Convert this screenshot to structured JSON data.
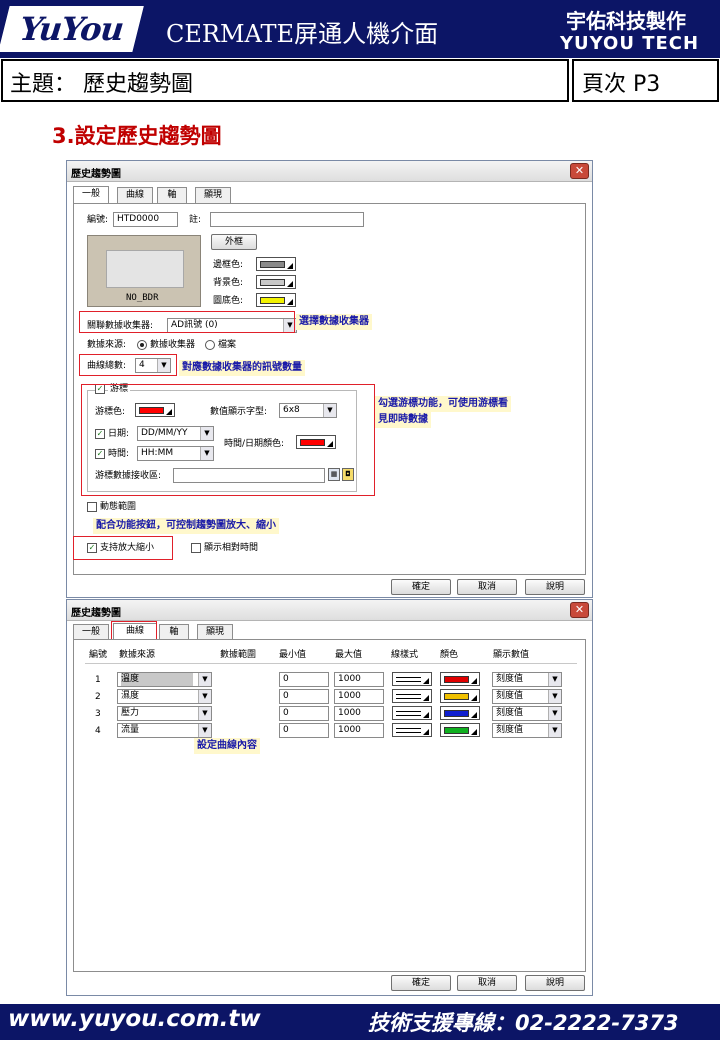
{
  "header": {
    "logo_text": "YuYou",
    "title": "CERMATE屏通人機介面",
    "company_cn": "宇佑科技製作",
    "company_en": "YUYOU TECH",
    "colors": {
      "bar": "#0c1566",
      "section_title": "#c00000",
      "annotation_text": "#1a1aa8"
    }
  },
  "subject": {
    "label": "主題： 歷史趨勢圖",
    "page": "頁次  P3"
  },
  "section_title": "3.設定歷史趨勢圖",
  "dialog1": {
    "title": "歷史趨勢圖",
    "tabs": [
      "一般",
      "曲線",
      "軸",
      "顯現"
    ],
    "selected_tab": "一般",
    "id_label": "編號:",
    "id_value": "HTD0000",
    "note_label": "註:",
    "note_value": "",
    "frame_button": "外框",
    "preview_label": "NO_BDR",
    "border_color_label": "邊框色:",
    "bg_color_label": "背景色:",
    "plot_color_label": "圖底色:",
    "collector_label": "關聯數據收集器:",
    "collector_value": "AD訊號 (0)",
    "source_label": "數據來源:",
    "source_opt1": "數據收集器",
    "source_opt2": "檔案",
    "curve_count_label": "曲線總數:",
    "curve_count_value": "4",
    "cursor_group_label": "游標",
    "cursor_color_label": "游標色:",
    "value_font_label": "數值顯示字型:",
    "value_font_value": "6x8",
    "date_label": "日期:",
    "date_value": "DD/MM/YY",
    "time_label": "時間:",
    "time_value": "HH:MM",
    "datetime_color_label": "時間/日期顏色:",
    "cursor_data_label": "游標數據接收區:",
    "dynamic_range_label": "動態範圍",
    "zoom_label": "支持放大縮小",
    "relative_time_label": "顯示相對時間",
    "ok": "確定",
    "cancel": "取消",
    "help": "說明",
    "notes": {
      "collector": "選擇數據收集器",
      "curve_count": "對應數據收集器的訊號數量",
      "cursor_line1": "勾選游標功能，可使用游標看",
      "cursor_line2": "見即時數據",
      "zoom": "配合功能按鈕，可控制趨勢圖放大、縮小"
    }
  },
  "dialog2": {
    "title": "歷史趨勢圖",
    "tabs": [
      "一般",
      "曲線",
      "軸",
      "顯現"
    ],
    "selected_tab": "曲線",
    "columns": [
      "編號",
      "數據來源",
      "數據範圍",
      "最小值",
      "最大值",
      "線樣式",
      "顏色",
      "顯示數值"
    ],
    "rows": [
      {
        "no": "1",
        "source": "溫度",
        "min": "0",
        "max": "1000",
        "color": "#e00000",
        "display": "刻度值"
      },
      {
        "no": "2",
        "source": "濕度",
        "min": "0",
        "max": "1000",
        "color": "#f0c000",
        "display": "刻度值"
      },
      {
        "no": "3",
        "source": "壓力",
        "min": "0",
        "max": "1000",
        "color": "#1020d0",
        "display": "刻度值"
      },
      {
        "no": "4",
        "source": "流量",
        "min": "0",
        "max": "1000",
        "color": "#10b020",
        "display": "刻度值"
      }
    ],
    "note": "設定曲線內容",
    "ok": "確定",
    "cancel": "取消",
    "help": "說明"
  },
  "footer": {
    "url": "www.yuyou.com.tw",
    "hotline": "技術支援專線：02-2222-7373"
  }
}
